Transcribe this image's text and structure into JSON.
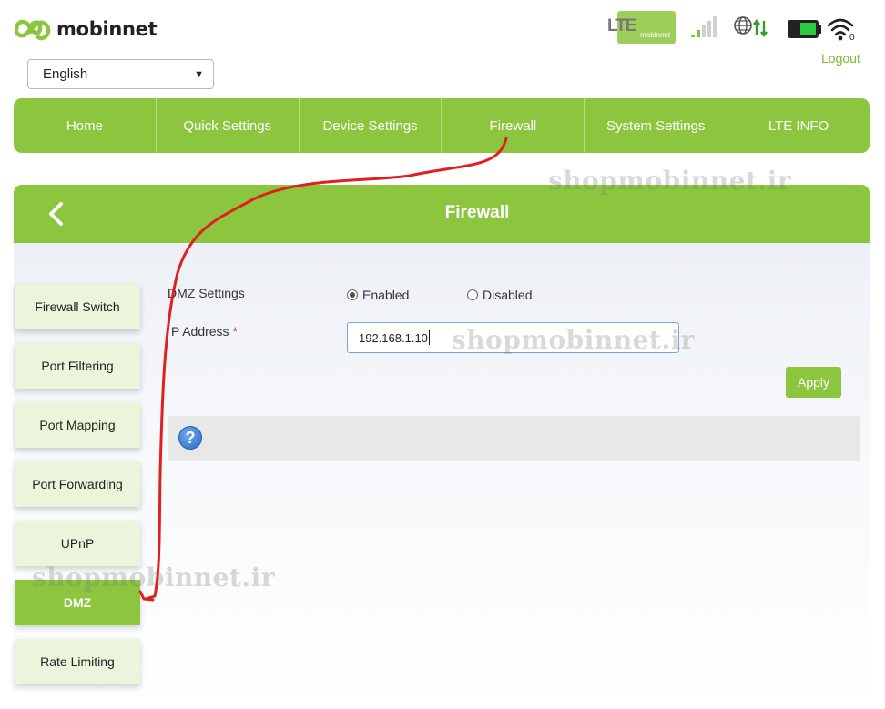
{
  "brand": {
    "name": "mobinnet"
  },
  "language": {
    "selected": "English"
  },
  "status_bar": {
    "network_type": "LTE",
    "sim_label": "mobinnet",
    "icons": [
      "lte-sim-icon",
      "signal-strength-icon",
      "internet-globe-icon",
      "battery-icon",
      "wifi-icon"
    ],
    "wifi_clients": "0"
  },
  "header": {
    "logout_label": "Logout"
  },
  "nav": {
    "items": [
      {
        "label": "Home"
      },
      {
        "label": "Quick Settings"
      },
      {
        "label": "Device Settings"
      },
      {
        "label": "Firewall"
      },
      {
        "label": "System Settings"
      },
      {
        "label": "LTE INFO"
      }
    ],
    "active": "Firewall"
  },
  "panel": {
    "title": "Firewall",
    "back_icon": "chevron-left-icon"
  },
  "sidebar": {
    "items": [
      {
        "label": "Firewall Switch"
      },
      {
        "label": "Port Filtering"
      },
      {
        "label": "Port Mapping"
      },
      {
        "label": "Port Forwarding"
      },
      {
        "label": "UPnP"
      },
      {
        "label": "DMZ"
      },
      {
        "label": "Rate Limiting"
      }
    ],
    "active": "DMZ"
  },
  "form": {
    "dmz_label": "DMZ Settings",
    "enabled_label": "Enabled",
    "disabled_label": "Disabled",
    "dmz_value": "Enabled",
    "ip_label": "P Address",
    "required_mark": "*",
    "ip_value": "192.168.1.10",
    "apply_label": "Apply"
  },
  "help": {
    "icon": "help-question-icon",
    "glyph": "?"
  },
  "watermark": {
    "text": "shopmobinnet.ir"
  },
  "colors": {
    "brand_green": "#8cc63f",
    "annotation_red": "#e02020"
  }
}
